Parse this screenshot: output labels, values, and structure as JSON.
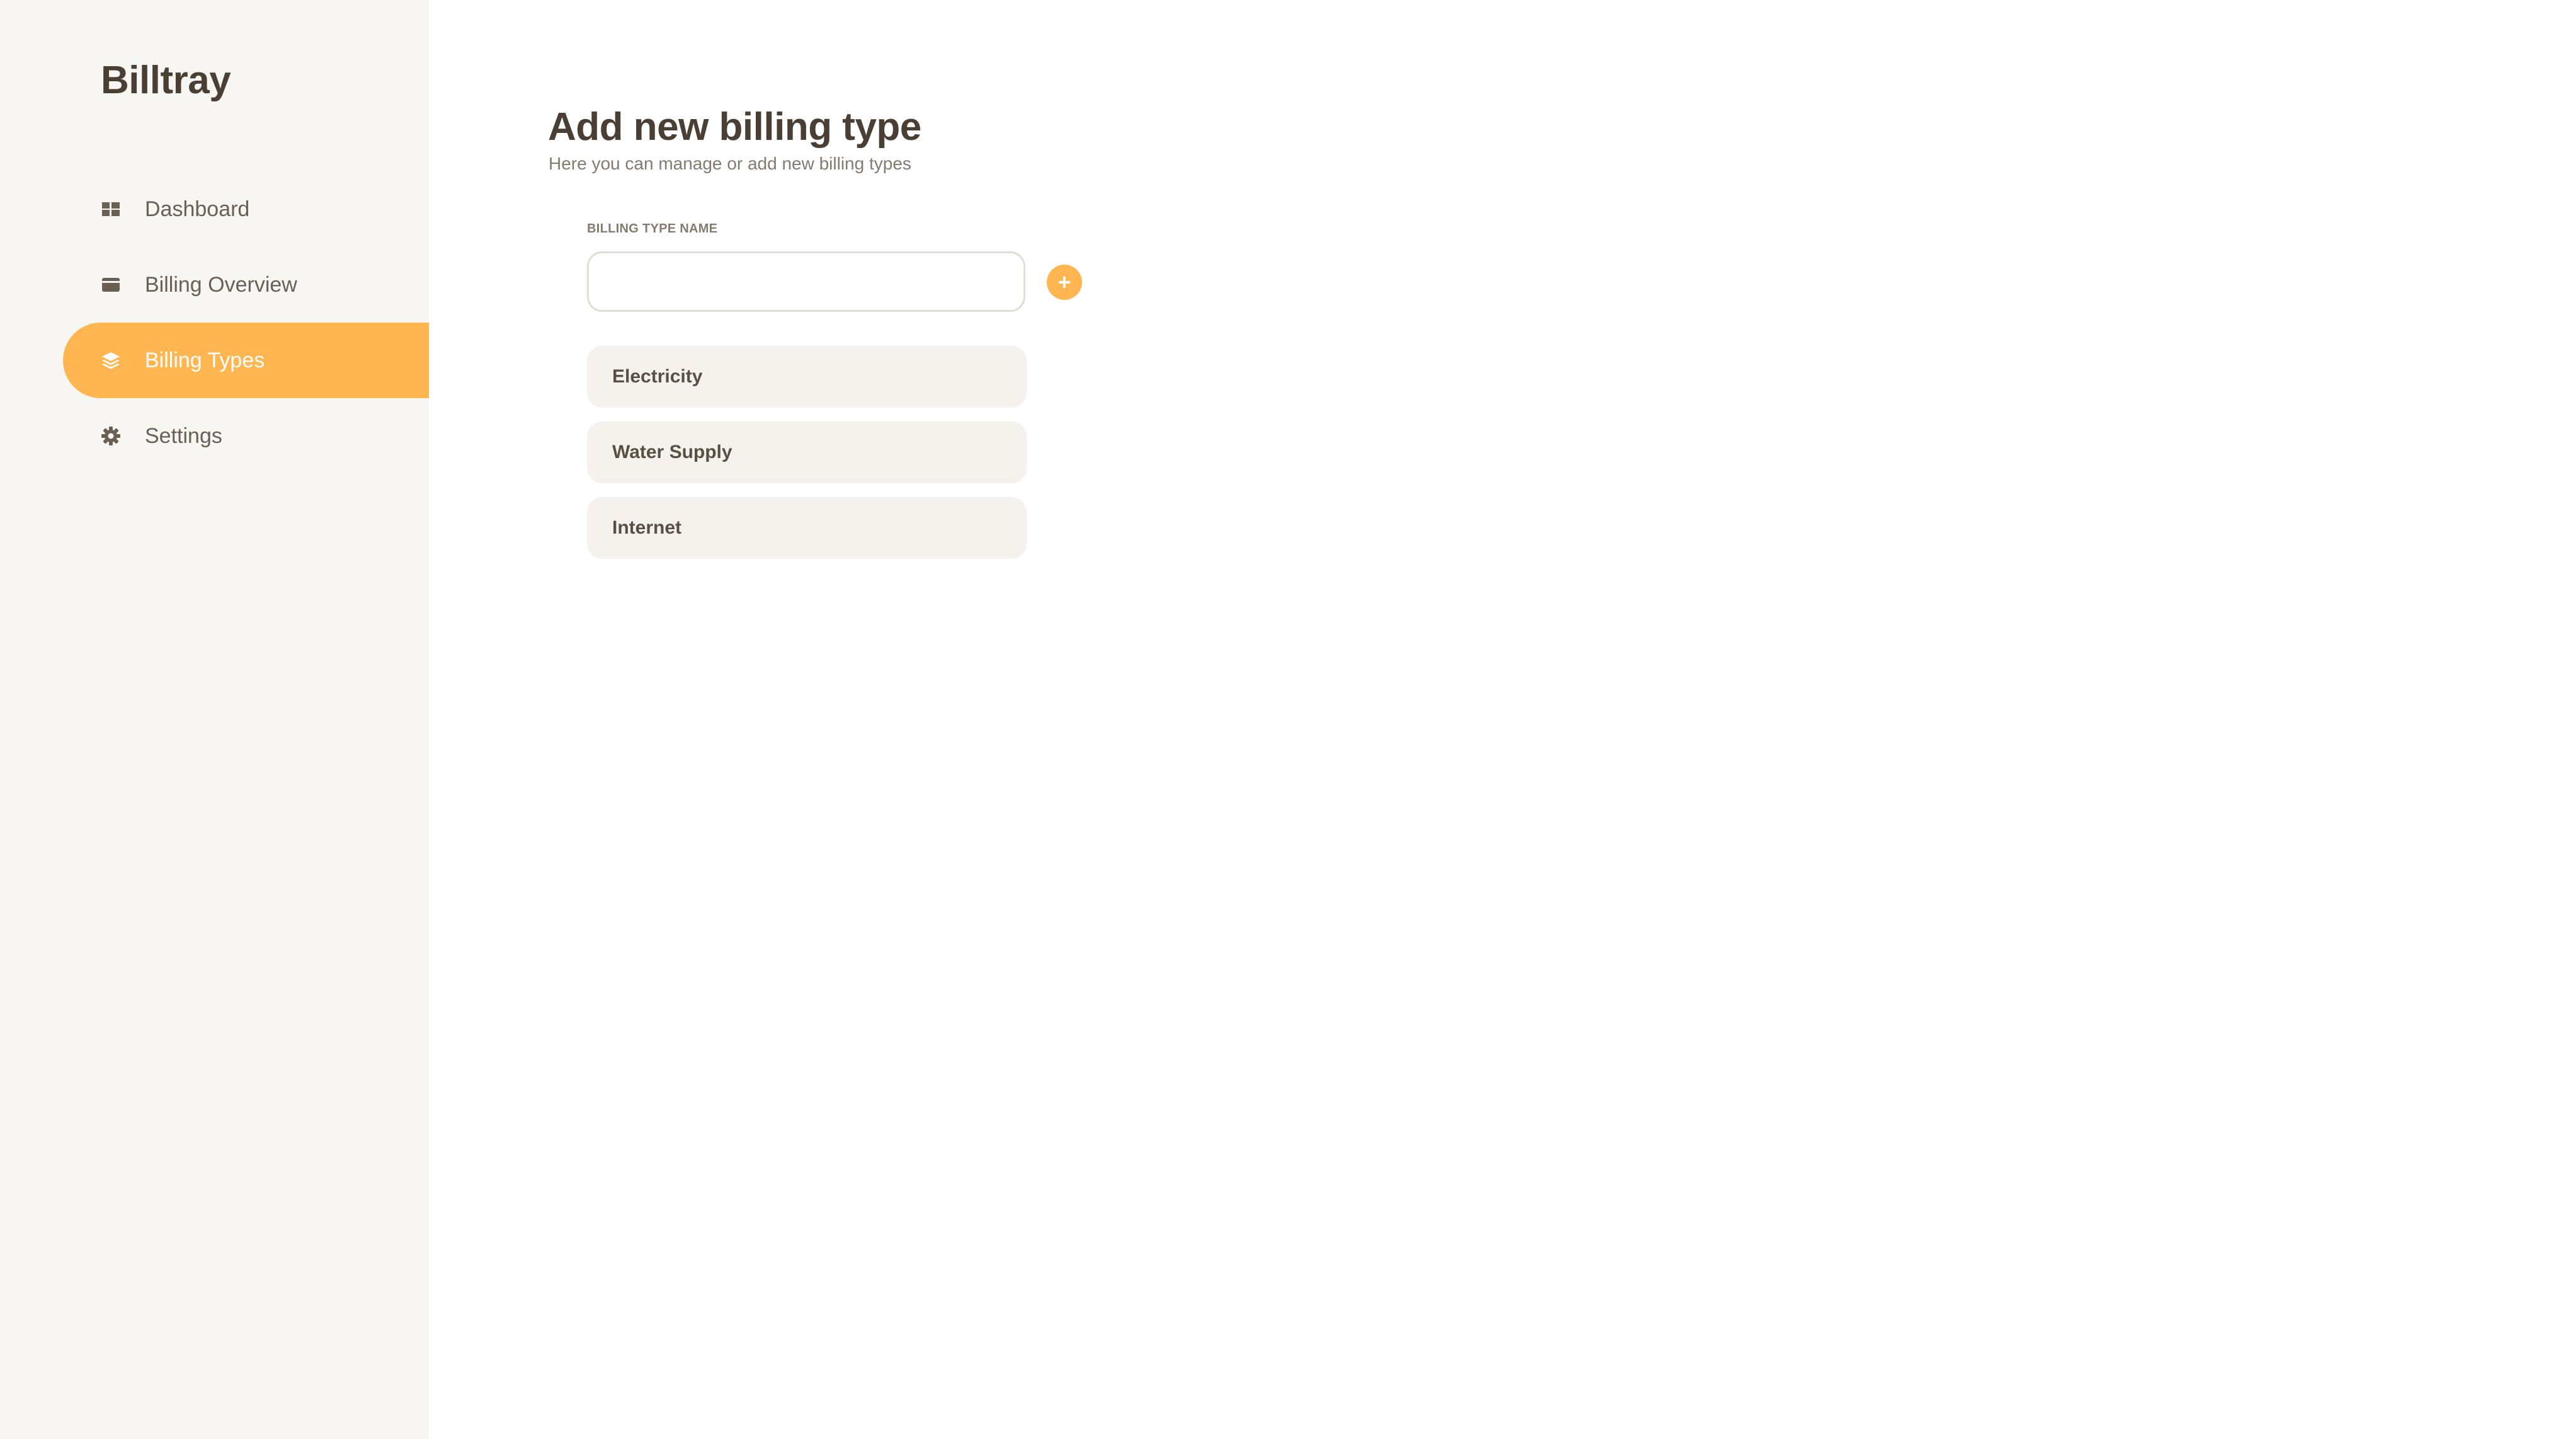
{
  "app": {
    "brand": "Billtray"
  },
  "sidebar": {
    "items": [
      {
        "label": "Dashboard",
        "icon": "dashboard-icon",
        "active": false
      },
      {
        "label": "Billing Overview",
        "icon": "wallet-icon",
        "active": false
      },
      {
        "label": "Billing Types",
        "icon": "layers-icon",
        "active": true
      },
      {
        "label": "Settings",
        "icon": "gear-icon",
        "active": false
      }
    ]
  },
  "main": {
    "title": "Add new billing type",
    "subtitle": "Here you can manage or add new billing types",
    "form": {
      "field_label": "BILLING TYPE NAME",
      "value": "",
      "placeholder": "",
      "add_icon": "plus-circle-icon"
    },
    "billing_types": [
      {
        "label": "Electricity"
      },
      {
        "label": "Water Supply"
      },
      {
        "label": "Internet"
      }
    ]
  },
  "colors": {
    "accent": "#ffb550",
    "sidebar_bg": "#f8f6f3",
    "text_dark": "#4a3f35",
    "text_muted": "#857a70",
    "list_item_bg": "#f5f2ee"
  }
}
